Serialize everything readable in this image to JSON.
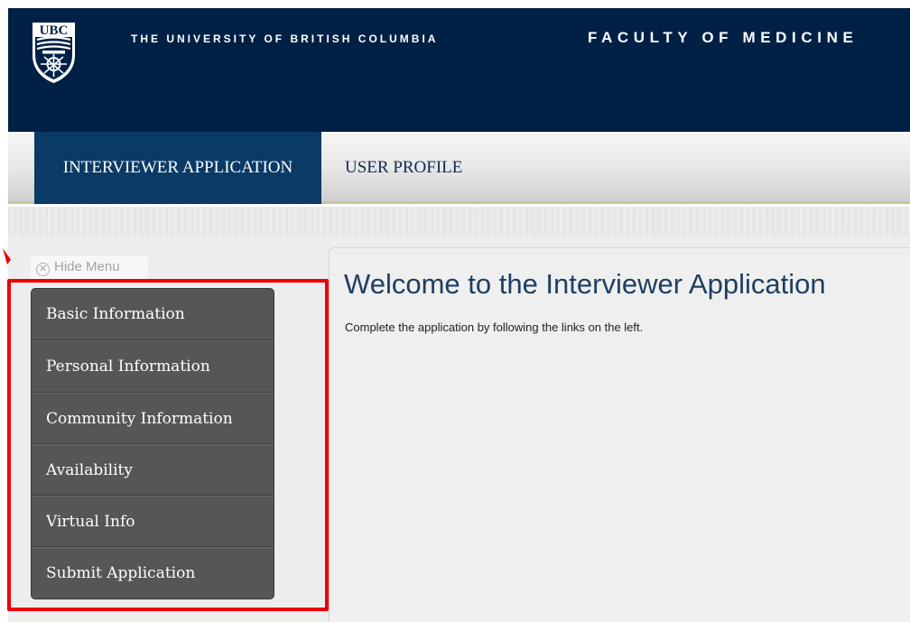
{
  "header": {
    "logo_text": "UBC",
    "university_name": "THE UNIVERSITY OF BRITISH COLUMBIA",
    "faculty_name": "FACULTY OF MEDICINE",
    "background_color": "#002145"
  },
  "nav": {
    "tabs": [
      {
        "label": "INTERVIEWER APPLICATION",
        "active": true
      },
      {
        "label": "USER PROFILE",
        "active": false
      }
    ]
  },
  "sidebar": {
    "hide_menu_label": "Hide Menu",
    "hide_menu_icon": "close-icon",
    "items": [
      {
        "label": "Basic Information"
      },
      {
        "label": "Personal Information"
      },
      {
        "label": "Community Information"
      },
      {
        "label": "Availability"
      },
      {
        "label": "Virtual Info"
      },
      {
        "label": "Submit Application"
      }
    ],
    "highlight_color": "#ee0000"
  },
  "main": {
    "title": "Welcome to the Interviewer Application",
    "instruction": "Complete the application by following the links on the left."
  }
}
